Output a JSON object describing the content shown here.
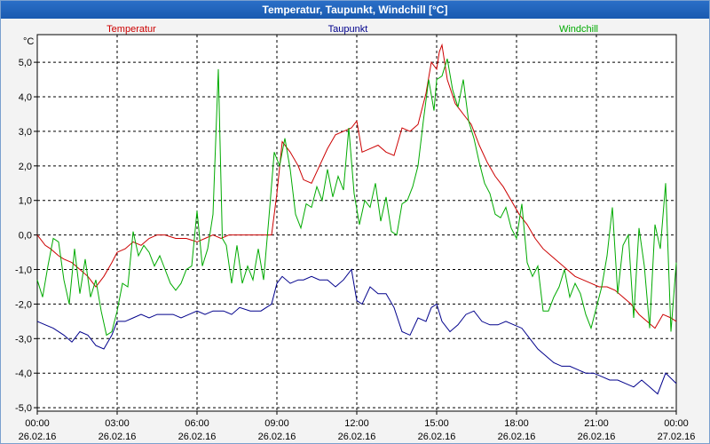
{
  "window": {
    "title": "Temperatur, Taupunkt, Windchill [°C]"
  },
  "chart_data": {
    "type": "line",
    "title": "Temperatur, Taupunkt, Windchill [°C]",
    "ylabel": "°C",
    "ylim": [
      -5.1,
      5.8
    ],
    "y_ticks": [
      "5,0",
      "4,0",
      "3,0",
      "2,0",
      "1,0",
      "0,0",
      "-1,0",
      "-2,0",
      "-3,0",
      "-4,0",
      "-5,0"
    ],
    "y_tick_values": [
      5,
      4,
      3,
      2,
      1,
      0,
      -1,
      -2,
      -3,
      -4,
      -5
    ],
    "x_ticks": [
      {
        "time": "00:00",
        "date": "26.02.16"
      },
      {
        "time": "03:00",
        "date": "26.02.16"
      },
      {
        "time": "06:00",
        "date": "26.02.16"
      },
      {
        "time": "09:00",
        "date": "26.02.16"
      },
      {
        "time": "12:00",
        "date": "26.02.16"
      },
      {
        "time": "15:00",
        "date": "26.02.16"
      },
      {
        "time": "18:00",
        "date": "26.02.16"
      },
      {
        "time": "21:00",
        "date": "26.02.16"
      },
      {
        "time": "00:00",
        "date": "27.02.16"
      }
    ],
    "grid": true,
    "legend": [
      {
        "name": "Temperatur",
        "color": "#cc0000",
        "position": "left"
      },
      {
        "name": "Taupunkt",
        "color": "#00008b",
        "position": "center"
      },
      {
        "name": "Windchill",
        "color": "#00aa00",
        "position": "right"
      }
    ],
    "series": [
      {
        "name": "Temperatur",
        "color": "#cc0000",
        "x": [
          0.0,
          0.3,
          0.5,
          0.8,
          1.0,
          1.3,
          1.6,
          1.9,
          2.2,
          2.5,
          2.8,
          3.0,
          3.3,
          3.6,
          3.9,
          4.2,
          4.5,
          4.8,
          5.2,
          5.6,
          6.0,
          6.3,
          6.6,
          6.9,
          7.2,
          7.6,
          8.0,
          8.4,
          8.8,
          9.0,
          9.2,
          9.5,
          9.8,
          10.0,
          10.3,
          10.6,
          10.9,
          11.2,
          11.5,
          11.8,
          12.0,
          12.2,
          12.5,
          12.8,
          13.1,
          13.4,
          13.7,
          14.0,
          14.3,
          14.6,
          14.8,
          15.0,
          15.1,
          15.2,
          15.4,
          15.7,
          16.0,
          16.3,
          16.6,
          16.9,
          17.2,
          17.5,
          17.8,
          18.1,
          18.4,
          18.7,
          19.0,
          19.3,
          19.6,
          19.9,
          20.2,
          20.5,
          20.8,
          21.1,
          21.4,
          21.7,
          22.0,
          22.3,
          22.6,
          22.9,
          23.2,
          23.5,
          23.8,
          24.0
        ],
        "values": [
          0.0,
          -0.3,
          -0.4,
          -0.6,
          -0.7,
          -0.8,
          -1.0,
          -1.2,
          -1.5,
          -1.2,
          -0.8,
          -0.5,
          -0.4,
          -0.2,
          -0.3,
          -0.1,
          0.0,
          0.0,
          -0.1,
          -0.1,
          -0.2,
          -0.1,
          0.0,
          -0.1,
          0.0,
          0.0,
          0.0,
          0.0,
          0.0,
          1.2,
          2.7,
          2.4,
          2.0,
          1.6,
          1.5,
          2.0,
          2.5,
          2.9,
          3.0,
          3.1,
          3.3,
          2.4,
          2.5,
          2.6,
          2.4,
          2.3,
          3.1,
          3.0,
          3.2,
          4.1,
          5.0,
          4.8,
          5.3,
          5.5,
          4.5,
          3.8,
          3.5,
          3.2,
          2.6,
          2.1,
          1.7,
          1.4,
          1.0,
          0.6,
          0.3,
          -0.1,
          -0.4,
          -0.6,
          -0.8,
          -1.0,
          -1.2,
          -1.3,
          -1.4,
          -1.5,
          -1.5,
          -1.6,
          -1.8,
          -2.0,
          -2.3,
          -2.5,
          -2.7,
          -2.3,
          -2.4,
          -2.5
        ]
      },
      {
        "name": "Taupunkt",
        "color": "#00008b",
        "x": [
          0.0,
          0.3,
          0.6,
          1.0,
          1.3,
          1.6,
          1.9,
          2.2,
          2.5,
          2.8,
          3.0,
          3.3,
          3.6,
          3.9,
          4.2,
          4.5,
          4.8,
          5.1,
          5.4,
          5.7,
          6.0,
          6.3,
          6.6,
          7.0,
          7.3,
          7.6,
          8.0,
          8.4,
          8.8,
          9.0,
          9.2,
          9.5,
          9.8,
          10.0,
          10.3,
          10.6,
          10.9,
          11.2,
          11.5,
          11.8,
          12.0,
          12.2,
          12.5,
          12.8,
          13.1,
          13.4,
          13.7,
          14.0,
          14.3,
          14.6,
          14.8,
          15.0,
          15.2,
          15.5,
          15.8,
          16.1,
          16.4,
          16.7,
          17.0,
          17.3,
          17.6,
          17.9,
          18.2,
          18.5,
          18.8,
          19.1,
          19.4,
          19.7,
          20.0,
          20.3,
          20.6,
          20.9,
          21.2,
          21.5,
          21.8,
          22.1,
          22.4,
          22.7,
          23.0,
          23.3,
          23.6,
          24.0
        ],
        "values": [
          -2.5,
          -2.6,
          -2.7,
          -2.9,
          -3.1,
          -2.8,
          -2.9,
          -3.2,
          -3.3,
          -2.9,
          -2.5,
          -2.5,
          -2.4,
          -2.3,
          -2.4,
          -2.3,
          -2.3,
          -2.3,
          -2.4,
          -2.3,
          -2.2,
          -2.3,
          -2.2,
          -2.2,
          -2.3,
          -2.1,
          -2.2,
          -2.2,
          -2.0,
          -1.4,
          -1.2,
          -1.4,
          -1.3,
          -1.3,
          -1.2,
          -1.3,
          -1.3,
          -1.5,
          -1.3,
          -1.0,
          -1.9,
          -2.0,
          -1.5,
          -1.7,
          -1.7,
          -2.1,
          -2.8,
          -2.9,
          -2.4,
          -2.5,
          -2.1,
          -2.0,
          -2.5,
          -2.8,
          -2.6,
          -2.3,
          -2.2,
          -2.5,
          -2.6,
          -2.6,
          -2.5,
          -2.6,
          -2.7,
          -3.0,
          -3.3,
          -3.5,
          -3.7,
          -3.8,
          -3.8,
          -3.9,
          -4.0,
          -4.0,
          -4.1,
          -4.2,
          -4.2,
          -4.3,
          -4.4,
          -4.2,
          -4.4,
          -4.6,
          -4.0,
          -4.3
        ]
      },
      {
        "name": "Windchill",
        "color": "#00aa00",
        "x": [
          0.0,
          0.2,
          0.4,
          0.6,
          0.8,
          1.0,
          1.2,
          1.4,
          1.6,
          1.8,
          2.0,
          2.2,
          2.4,
          2.6,
          2.8,
          3.0,
          3.2,
          3.4,
          3.6,
          3.8,
          4.0,
          4.2,
          4.4,
          4.6,
          4.8,
          5.0,
          5.2,
          5.4,
          5.6,
          5.8,
          6.0,
          6.2,
          6.4,
          6.6,
          6.8,
          6.95,
          7.1,
          7.3,
          7.5,
          7.7,
          7.9,
          8.1,
          8.3,
          8.5,
          8.7,
          8.9,
          9.1,
          9.3,
          9.5,
          9.7,
          9.9,
          10.1,
          10.3,
          10.5,
          10.7,
          10.9,
          11.1,
          11.3,
          11.5,
          11.7,
          11.9,
          12.1,
          12.3,
          12.5,
          12.7,
          12.9,
          13.1,
          13.3,
          13.5,
          13.7,
          13.9,
          14.1,
          14.3,
          14.5,
          14.7,
          14.9,
          15.0,
          15.2,
          15.4,
          15.6,
          15.8,
          16.0,
          16.2,
          16.4,
          16.6,
          16.8,
          17.0,
          17.2,
          17.4,
          17.6,
          17.8,
          18.0,
          18.2,
          18.4,
          18.6,
          18.8,
          19.0,
          19.2,
          19.4,
          19.6,
          19.8,
          20.0,
          20.2,
          20.4,
          20.6,
          20.8,
          21.0,
          21.2,
          21.4,
          21.6,
          21.8,
          22.0,
          22.2,
          22.4,
          22.6,
          22.8,
          23.0,
          23.2,
          23.4,
          23.6,
          23.8,
          24.0
        ],
        "values": [
          -1.3,
          -1.8,
          -0.9,
          -0.1,
          -0.2,
          -1.3,
          -2.0,
          -0.4,
          -1.7,
          -0.7,
          -1.8,
          -1.3,
          -2.2,
          -2.9,
          -2.8,
          -2.2,
          -1.4,
          -1.5,
          0.1,
          -0.6,
          -0.3,
          -0.5,
          -0.9,
          -0.6,
          -1.0,
          -1.4,
          -1.6,
          -1.4,
          -1.0,
          -0.9,
          0.7,
          -0.9,
          -0.4,
          0.6,
          4.8,
          -0.1,
          -0.3,
          -1.4,
          -0.3,
          -1.4,
          -0.9,
          -1.3,
          -0.4,
          -1.3,
          0.5,
          2.4,
          2.0,
          2.8,
          1.9,
          0.6,
          0.2,
          0.9,
          0.8,
          1.4,
          1.0,
          1.9,
          1.1,
          1.7,
          1.3,
          3.1,
          1.2,
          0.3,
          1.0,
          0.8,
          1.5,
          0.4,
          1.1,
          0.1,
          0.0,
          0.9,
          1.0,
          1.4,
          2.0,
          3.3,
          4.5,
          3.6,
          4.5,
          4.6,
          5.1,
          4.2,
          3.7,
          4.5,
          3.3,
          2.8,
          2.1,
          1.5,
          1.2,
          0.6,
          0.5,
          0.8,
          0.2,
          -0.1,
          0.9,
          -0.8,
          -1.2,
          -0.9,
          -2.2,
          -2.2,
          -1.8,
          -1.5,
          -1.0,
          -1.8,
          -1.4,
          -1.7,
          -2.3,
          -2.7,
          -2.1,
          -1.5,
          -0.6,
          0.8,
          -1.7,
          -0.3,
          0.0,
          -2.4,
          0.2,
          -0.9,
          -2.7,
          0.3,
          -0.4,
          1.5,
          -2.8,
          -0.8
        ]
      }
    ]
  }
}
